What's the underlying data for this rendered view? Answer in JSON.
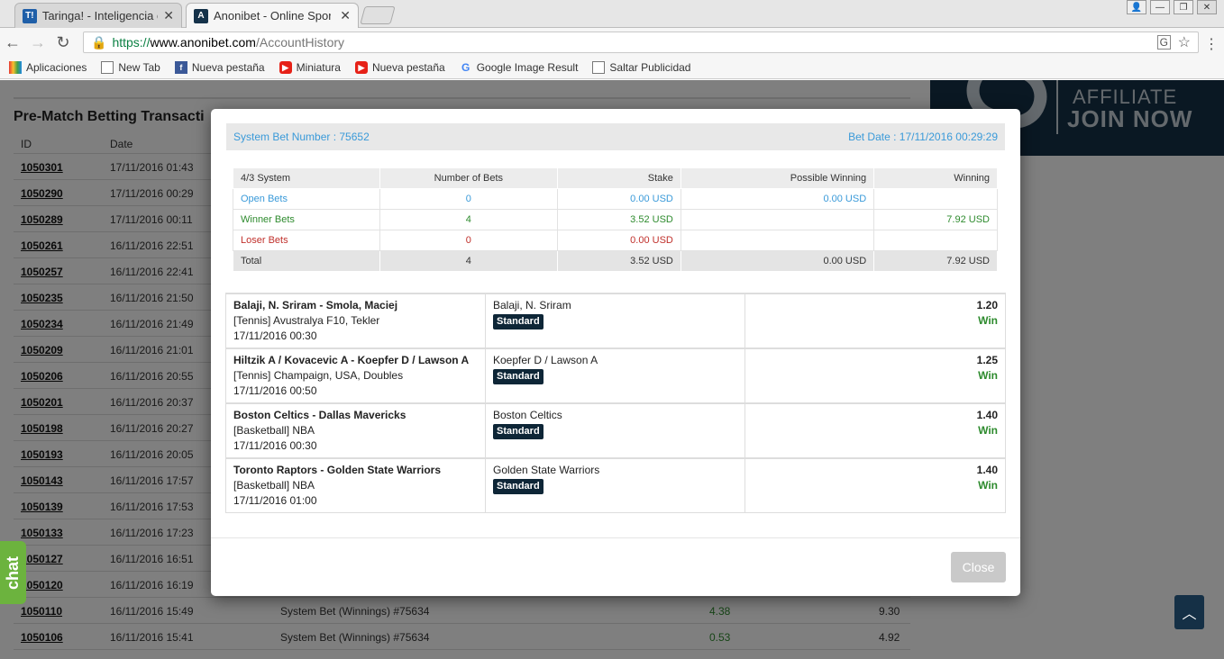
{
  "browser": {
    "tabs": [
      {
        "title": "Taringa! - Inteligencia co",
        "favicon": "T!"
      },
      {
        "title": "Anonibet - Online Sports",
        "favicon": "A"
      }
    ],
    "url_scheme": "https://",
    "url_host": "www.anonibet.com",
    "url_path": "/AccountHistory",
    "bookmarks": [
      "Aplicaciones",
      "New Tab",
      "Nueva pestaña",
      "Miniatura",
      "Nueva pestaña",
      "Google Image Result",
      "Saltar Publicidad"
    ]
  },
  "page": {
    "section_title": "Pre-Match Betting Transacti",
    "columns": {
      "id": "ID",
      "date": "Date"
    },
    "rows": [
      {
        "id": "1050301",
        "date": "17/11/2016 01:43",
        "desc": "",
        "amount": "",
        "balance": ""
      },
      {
        "id": "1050290",
        "date": "17/11/2016 00:29",
        "desc": "",
        "amount": "",
        "balance": ""
      },
      {
        "id": "1050289",
        "date": "17/11/2016 00:11",
        "desc": "",
        "amount": "",
        "balance": ""
      },
      {
        "id": "1050261",
        "date": "16/11/2016 22:51",
        "desc": "",
        "amount": "",
        "balance": ""
      },
      {
        "id": "1050257",
        "date": "16/11/2016 22:41",
        "desc": "",
        "amount": "",
        "balance": ""
      },
      {
        "id": "1050235",
        "date": "16/11/2016 21:50",
        "desc": "",
        "amount": "",
        "balance": ""
      },
      {
        "id": "1050234",
        "date": "16/11/2016 21:49",
        "desc": "",
        "amount": "",
        "balance": ""
      },
      {
        "id": "1050209",
        "date": "16/11/2016 21:01",
        "desc": "",
        "amount": "",
        "balance": ""
      },
      {
        "id": "1050206",
        "date": "16/11/2016 20:55",
        "desc": "",
        "amount": "",
        "balance": ""
      },
      {
        "id": "1050201",
        "date": "16/11/2016 20:37",
        "desc": "",
        "amount": "",
        "balance": ""
      },
      {
        "id": "1050198",
        "date": "16/11/2016 20:27",
        "desc": "",
        "amount": "",
        "balance": ""
      },
      {
        "id": "1050193",
        "date": "16/11/2016 20:05",
        "desc": "",
        "amount": "",
        "balance": ""
      },
      {
        "id": "1050143",
        "date": "16/11/2016 17:57",
        "desc": "",
        "amount": "",
        "balance": ""
      },
      {
        "id": "1050139",
        "date": "16/11/2016 17:53",
        "desc": "",
        "amount": "",
        "balance": ""
      },
      {
        "id": "1050133",
        "date": "16/11/2016 17:23",
        "desc": "",
        "amount": "",
        "balance": ""
      },
      {
        "id": "1050127",
        "date": "16/11/2016 16:51",
        "desc": "",
        "amount": "",
        "balance": ""
      },
      {
        "id": "1050120",
        "date": "16/11/2016 16:19",
        "desc": "",
        "amount": "",
        "balance": ""
      },
      {
        "id": "1050110",
        "date": "16/11/2016 15:49",
        "desc": "System Bet (Winnings) #75634",
        "amount": "4.38",
        "balance": "9.30"
      },
      {
        "id": "1050106",
        "date": "16/11/2016 15:41",
        "desc": "System Bet (Winnings) #75634",
        "amount": "0.53",
        "balance": "4.92"
      }
    ],
    "banner": {
      "line1": "AFFILIATE",
      "line2": "JOIN NOW"
    },
    "chat_label": "chat"
  },
  "modal": {
    "bet_number": "System Bet Number : 75652",
    "bet_date": "Bet Date : 17/11/2016 00:29:29",
    "summary_header": [
      "4/3 System",
      "Number of Bets",
      "Stake",
      "Possible Winning",
      "Winning"
    ],
    "summary_rows": [
      {
        "label": "Open Bets",
        "count": "0",
        "stake": "0.00 USD",
        "possible": "0.00 USD",
        "winning": ""
      },
      {
        "label": "Winner Bets",
        "count": "4",
        "stake": "3.52 USD",
        "possible": "",
        "winning": "7.92 USD"
      },
      {
        "label": "Loser Bets",
        "count": "0",
        "stake": "0.00 USD",
        "possible": "",
        "winning": ""
      }
    ],
    "total": {
      "label": "Total",
      "count": "4",
      "stake": "3.52 USD",
      "possible": "0.00 USD",
      "winning": "7.92 USD"
    },
    "legs": [
      {
        "match": "Balaji, N. Sriram - Smola, Maciej",
        "league": "[Tennis] Avustralya F10, Tekler",
        "time": "17/11/2016 00:30",
        "selection": "Balaji, N. Sriram",
        "type": "Standard",
        "odds": "1.20",
        "result": "Win"
      },
      {
        "match": "Hiltzik A / Kovacevic A - Koepfer D / Lawson A",
        "league": "[Tennis] Champaign, USA, Doubles",
        "time": "17/11/2016 00:50",
        "selection": "Koepfer D / Lawson A",
        "type": "Standard",
        "odds": "1.25",
        "result": "Win"
      },
      {
        "match": "Boston Celtics - Dallas Mavericks",
        "league": "[Basketball] NBA",
        "time": "17/11/2016 00:30",
        "selection": "Boston Celtics",
        "type": "Standard",
        "odds": "1.40",
        "result": "Win"
      },
      {
        "match": "Toronto Raptors - Golden State Warriors",
        "league": "[Basketball] NBA",
        "time": "17/11/2016 01:00",
        "selection": "Golden State Warriors",
        "type": "Standard",
        "odds": "1.40",
        "result": "Win"
      }
    ],
    "close_label": "Close"
  }
}
